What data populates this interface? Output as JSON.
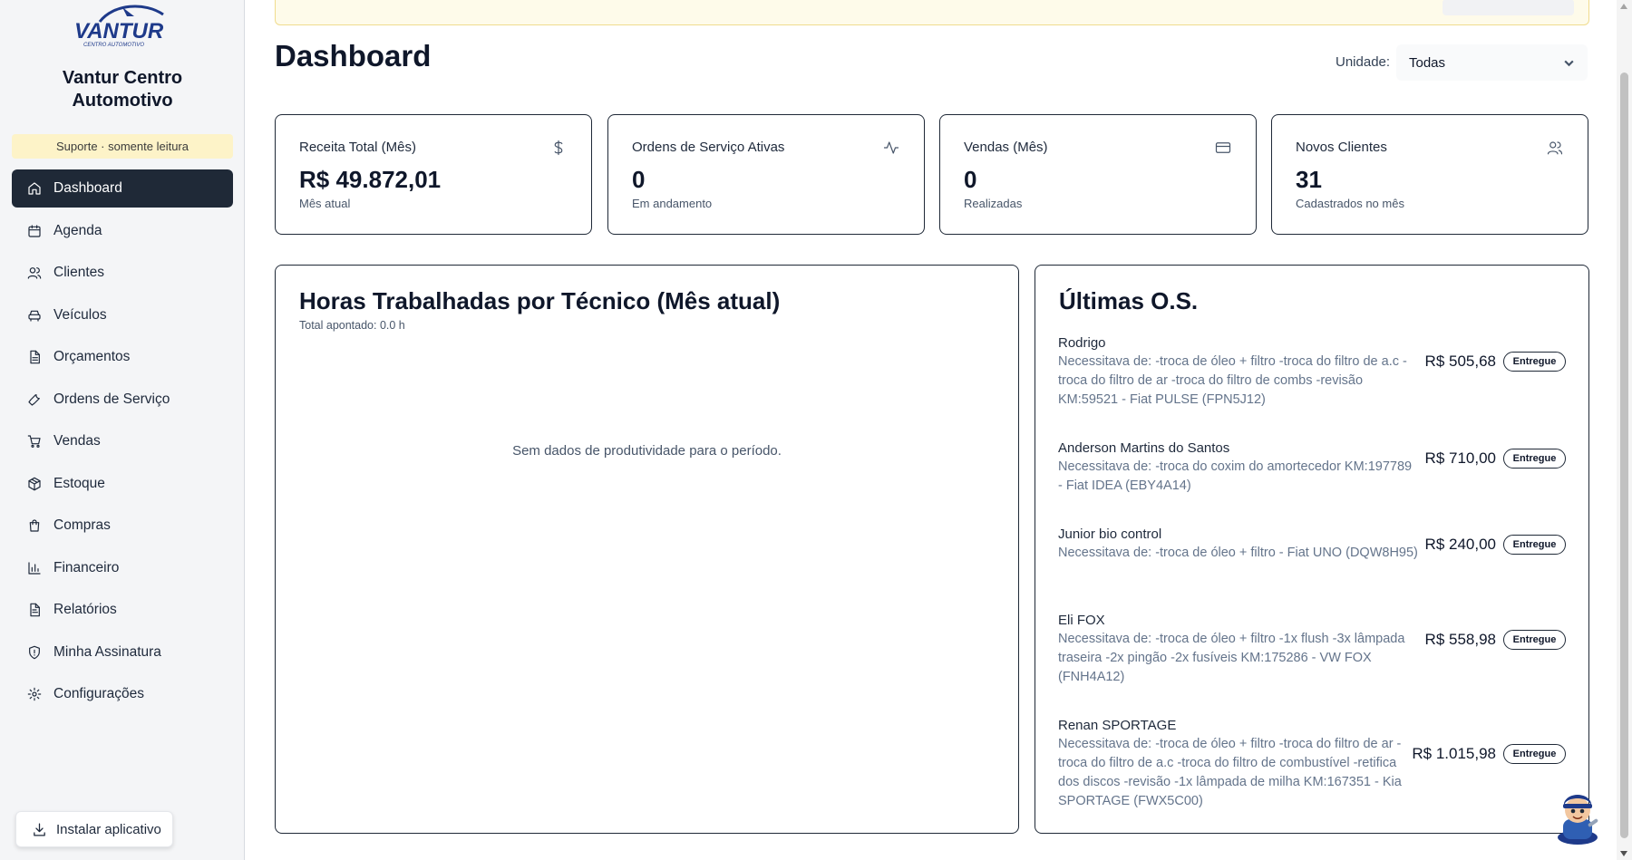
{
  "sidebar": {
    "logo_text": "VANTUR",
    "logo_tagline": "CENTRO AUTOMOTIVO",
    "brand_line1": "Vantur Centro",
    "brand_line2": "Automotivo",
    "support_badge": "Suporte · somente leitura",
    "items": [
      {
        "label": "Dashboard",
        "icon": "home-icon",
        "active": true
      },
      {
        "label": "Agenda",
        "icon": "calendar-icon"
      },
      {
        "label": "Clientes",
        "icon": "users-icon"
      },
      {
        "label": "Veículos",
        "icon": "car-icon"
      },
      {
        "label": "Orçamentos",
        "icon": "document-icon"
      },
      {
        "label": "Ordens de Serviço",
        "icon": "wrench-icon"
      },
      {
        "label": "Vendas",
        "icon": "cart-icon"
      },
      {
        "label": "Estoque",
        "icon": "package-icon"
      },
      {
        "label": "Compras",
        "icon": "shopping-bag-icon"
      },
      {
        "label": "Financeiro",
        "icon": "bar-chart-icon"
      },
      {
        "label": "Relatórios",
        "icon": "report-icon"
      },
      {
        "label": "Minha Assinatura",
        "icon": "shield-icon"
      },
      {
        "label": "Configurações",
        "icon": "gear-icon"
      }
    ],
    "install_label": "Instalar aplicativo"
  },
  "header": {
    "title": "Dashboard",
    "unit_label": "Unidade:",
    "unit_value": "Todas"
  },
  "stats": [
    {
      "label": "Receita Total (Mês)",
      "value": "R$ 49.872,01",
      "sub": "Mês atual",
      "icon": "dollar-icon"
    },
    {
      "label": "Ordens de Serviço Ativas",
      "value": "0",
      "sub": "Em andamento",
      "icon": "activity-icon"
    },
    {
      "label": "Vendas (Mês)",
      "value": "0",
      "sub": "Realizadas",
      "icon": "credit-card-icon"
    },
    {
      "label": "Novos Clientes",
      "value": "31",
      "sub": "Cadastrados no mês",
      "icon": "users-icon"
    }
  ],
  "hours_panel": {
    "title": "Horas Trabalhadas por Técnico (Mês atual)",
    "subtitle": "Total apontado: 0.0 h",
    "empty_message": "Sem dados de produtividade para o período."
  },
  "os_panel": {
    "title": "Últimas O.S.",
    "items": [
      {
        "client": "Rodrigo",
        "description": "Necessitava de: -troca de óleo + filtro -troca do filtro de a.c -troca do filtro de ar -troca do filtro de combs -revisão KM:59521 - Fiat PULSE (FPN5J12)",
        "value": "R$ 505,68",
        "status": "Entregue"
      },
      {
        "client": "Anderson Martins do Santos",
        "description": "Necessitava de: -troca do coxim do amortecedor KM:197789 - Fiat IDEA (EBY4A14)",
        "value": "R$ 710,00",
        "status": "Entregue"
      },
      {
        "client": "Junior bio control",
        "description": "Necessitava de: -troca de óleo + filtro - Fiat UNO (DQW8H95)",
        "value": "R$ 240,00",
        "status": "Entregue"
      },
      {
        "client": "Eli FOX",
        "description": "Necessitava de: -troca de óleo + filtro -1x flush -3x lâmpada traseira -2x pingão -2x fusíveis KM:175286 - VW FOX (FNH4A12)",
        "value": "R$ 558,98",
        "status": "Entregue"
      },
      {
        "client": "Renan SPORTAGE",
        "description": "Necessitava de: -troca de óleo + filtro -troca do filtro de ar -troca do filtro de a.c -troca do filtro de combustível -retifica dos discos -revisão -1x lâmpada de milha KM:167351 - Kia SPORTAGE (FWX5C00)",
        "value": "R$ 1.015,98",
        "status": "Entregue"
      }
    ]
  }
}
